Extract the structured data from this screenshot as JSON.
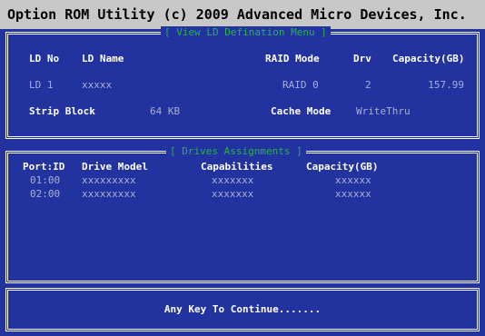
{
  "title": "Option ROM Utility (c) 2009 Advanced Micro Devices, Inc.",
  "ld_panel": {
    "title": "[ View LD Defination Menu ]",
    "headers": {
      "ld_no": "LD No",
      "ld_name": "LD Name",
      "raid_mode": "RAID Mode",
      "drv": "Drv",
      "capacity": "Capacity(GB)"
    },
    "row": {
      "ld_no": "LD  1",
      "ld_name": "xxxxx",
      "raid_mode": "RAID 0",
      "drv": "2",
      "capacity": "157.99"
    },
    "strip_block_label": "Strip Block",
    "strip_block_value": "64 KB",
    "cache_mode_label": "Cache Mode",
    "cache_mode_value": "WriteThru"
  },
  "drives_panel": {
    "title": "[ Drives Assignments ]",
    "headers": {
      "port_id": "Port:ID",
      "drive_model": "Drive Model",
      "capabilities": "Capabilities",
      "capacity": "Capacity(GB)"
    },
    "rows": [
      {
        "port_id": "01:00",
        "drive_model": "xxxxxxxxx",
        "capabilities": "xxxxxxx",
        "capacity": "xxxxxx"
      },
      {
        "port_id": "02:00",
        "drive_model": "xxxxxxxxx",
        "capabilities": "xxxxxxx",
        "capacity": "xxxxxx"
      }
    ]
  },
  "footer": {
    "prompt": "Any Key To Continue......."
  },
  "colors": {
    "background": "#2233a0",
    "title_bar": "#c8c8c8",
    "panel_title": "#27b34a",
    "dim_text": "#a8aed6"
  }
}
